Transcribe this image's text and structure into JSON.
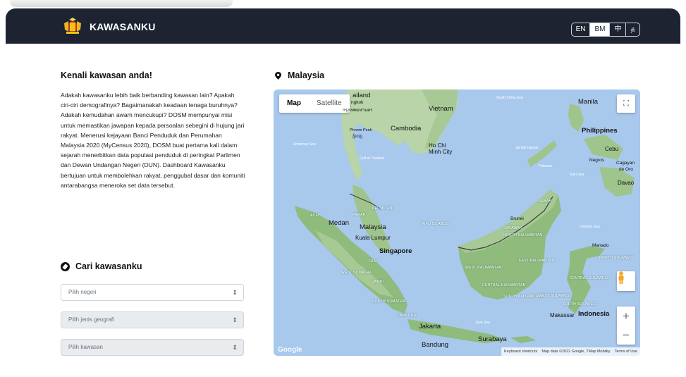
{
  "header": {
    "brand": "KAWASANKU",
    "languages": [
      {
        "label": "EN",
        "active": false
      },
      {
        "label": "BM",
        "active": true
      },
      {
        "label": "中",
        "active": false
      },
      {
        "label": "த",
        "active": false
      }
    ]
  },
  "about": {
    "title": "Kenali kawasan anda!",
    "text": "Adakah kawasanku lebih baik berbanding kawasan lain? Apakah ciri-ciri demografinya? Bagaimanakah keadaan tenaga buruhnya? Adakah kemudahan awam mencukupi? DOSM mempunyai misi untuk memastikan jawapan kepada persoalan sebegini di hujung jari rakyat. Menerusi kejayaan Banci Penduduk dan Perumahan Malaysia 2020 (MyCensus 2020), DOSM buat pertama kali dalam sejarah menerbitkan data populasi penduduk di peringkat Parlimen dan Dewan Undangan Negeri (DUN). Dashboard Kawasanku bertujuan untuk membolehkan rakyat, penggubal dasar dan komuniti antarabangsa meneroka set data tersebut."
  },
  "search": {
    "title": "Cari kawasanku",
    "state_placeholder": "Pilih negeri",
    "geo_placeholder": "Pilih jenis geografi",
    "area_placeholder": "Pilih kawasan"
  },
  "map": {
    "title": "Malaysia",
    "type_map": "Map",
    "type_satellite": "Satellite",
    "google": "Google",
    "attribution": [
      "Keyboard shortcuts",
      "Map data ©2022 Google, TMap Mobility",
      "Terms of Use"
    ],
    "labels": {
      "thailand": "ailand",
      "bangkok": "ngkok",
      "bangkok_native": "กรุงเทพมหานคร",
      "vietnam": "Vietnam",
      "cambodia": "Cambodia",
      "phnom_penh": "Phnom Penh",
      "phnom_penh_native": "ភ្នំពេញ",
      "hcm": "Ho Chi",
      "hcm2": "Minh City",
      "manila": "Manila",
      "philippines": "Philippines",
      "cebu": "Cebu",
      "negros": "Negros",
      "cagayan": "Cagayan",
      "cagayan2": "de Oro",
      "davao": "Davao",
      "medan": "Medan",
      "malaysia": "Malaysia",
      "kl": "Kuala Lumpur",
      "singapore": "Singapore",
      "jakarta": "Jakarta",
      "bandung": "Bandung",
      "surabaya": "Surabaya",
      "makassar": "Makassar",
      "indonesia": "Indonesia",
      "manado": "Manado",
      "brunei": "Brunei",
      "south_china_sea": "South China Sea",
      "andaman_sea": "Andaman Sea",
      "gulf_of_thailand": "Gulf of Thailand",
      "sulu_sea": "Sulu Sea",
      "celebes_sea": "Celebes Sea",
      "java_sea": "Java Sea",
      "spratly": "Spratly Islands",
      "palawan": "Palawan",
      "aceh": "ACEH",
      "kelantan": "KELANTAN",
      "perak": "PERAK",
      "riau": "RIAU",
      "jambi": "JAMBI",
      "west_sumatra": "WEST SUMATRA",
      "south_sumatra": "SOUTH SUMATRA",
      "lampung": "LAMPUNG",
      "riau_islands": "RIAU ISLANDS",
      "sarawak": "SARAWAK",
      "sabah": "SABAH",
      "north_kalimantan": "NORTH KALIMANTAN",
      "west_kalimantan": "WEST KALIMANTAN",
      "central_kalimantan": "CENTRAL KALIMANTAN",
      "south_kalimantan": "SOUTH KALIMANTAN",
      "east_kalimantan": "EAST KALIMANTAN",
      "north_sulawesi": "NORTH SULAWESI",
      "central_sulawesi": "CENTRAL SULAWESI",
      "west_sulawesi": "WEST SULAWESI",
      "south_sulawesi": "SOUTH SULAWESI"
    }
  }
}
